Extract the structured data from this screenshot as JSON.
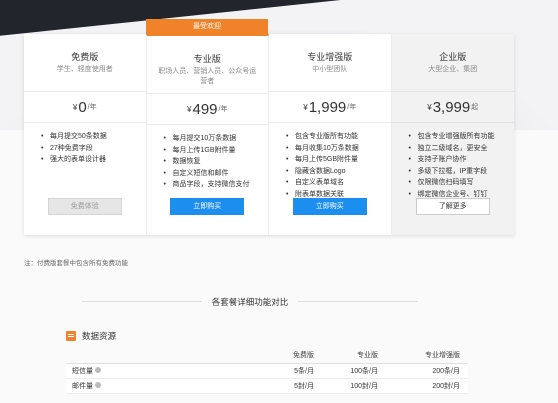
{
  "badge": "最受欢迎",
  "plans": [
    {
      "name": "免费版",
      "audience": "学生、轻度使用者",
      "currency": "¥",
      "amount": "0",
      "period": "/年",
      "features": [
        "每月提交50条数据",
        "27种免费字段",
        "强大的表单设计器"
      ],
      "button": "免费体验"
    },
    {
      "name": "专业版",
      "audience": "职场人员、营销人员、公众号运营者",
      "currency": "¥",
      "amount": "499",
      "period": "/年",
      "features": [
        "每月提交10万条数据",
        "每月上传1GB附件量",
        "数据恢复",
        "自定义短信和邮件",
        "商品字段，支持微信支付"
      ],
      "button": "立即购买"
    },
    {
      "name": "专业增强版",
      "audience": "中小型团队",
      "currency": "¥",
      "amount": "1,999",
      "period": "/年",
      "features": [
        "包含专业版所有功能",
        "每月收集10万条数据",
        "每月上传5GB附件量",
        "隐藏含数据Logo",
        "自定义表单域名",
        "附表单数据关联"
      ],
      "button": "立即购买"
    },
    {
      "name": "企业版",
      "audience": "大型企业、集团",
      "currency": "¥",
      "amount": "3,999",
      "period": "起",
      "features": [
        "包含专业增强版所有功能",
        "独立二级域名，更安全",
        "支持子账户协作",
        "多级下拉框，IP重字段",
        "仅限微信扫码填写",
        "绑定微信企业号、钉钉"
      ],
      "button": "了解更多"
    }
  ],
  "note": "注：付费版套餐中包含所有免费功能",
  "compare_title": "各套餐详细功能对比",
  "section": {
    "title": "数据资源"
  },
  "table": {
    "headers": [
      "",
      "免费版",
      "专业版",
      "专业增强版"
    ],
    "rows": [
      {
        "label": "短信量",
        "values": [
          "5条/月",
          "100条/月",
          "200条/月"
        ]
      },
      {
        "label": "邮件量",
        "values": [
          "5封/月",
          "100封/月",
          "200封/月"
        ]
      }
    ]
  }
}
